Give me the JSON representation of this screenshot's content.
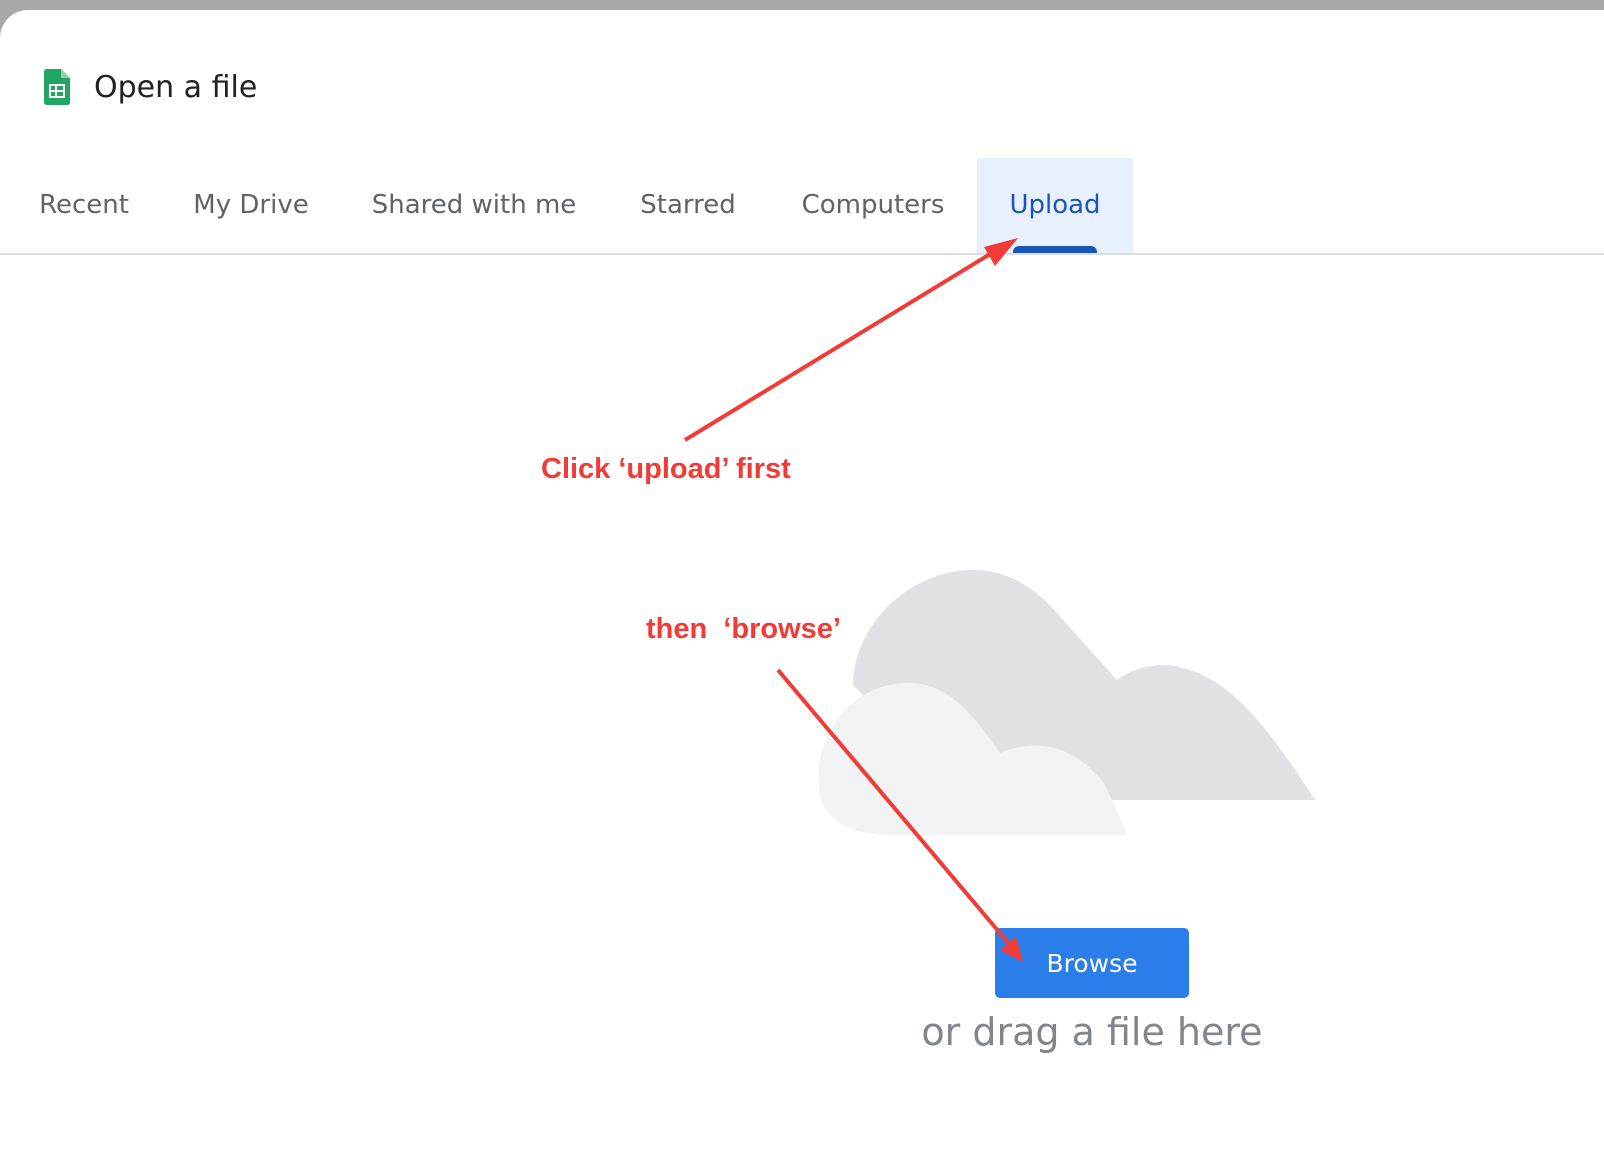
{
  "dialog": {
    "title": "Open a file",
    "icon": "google-sheets-icon"
  },
  "tabs": [
    {
      "label": "Recent",
      "active": false
    },
    {
      "label": "My Drive",
      "active": false
    },
    {
      "label": "Shared with me",
      "active": false
    },
    {
      "label": "Starred",
      "active": false
    },
    {
      "label": "Computers",
      "active": false
    },
    {
      "label": "Upload",
      "active": true
    }
  ],
  "upload": {
    "illustration": "cloud-illustration",
    "browse_label": "Browse",
    "drag_text": "or drag a file here"
  },
  "annotations": {
    "step1": "Click ‘upload’ first",
    "step2": "then  ‘browse’",
    "color": "#f23b36"
  },
  "colors": {
    "accent": "#1a56b8",
    "active_tab_bg": "#e8f0fe",
    "browse_button": "#2b7de9",
    "sheets_green": "#23a566"
  }
}
